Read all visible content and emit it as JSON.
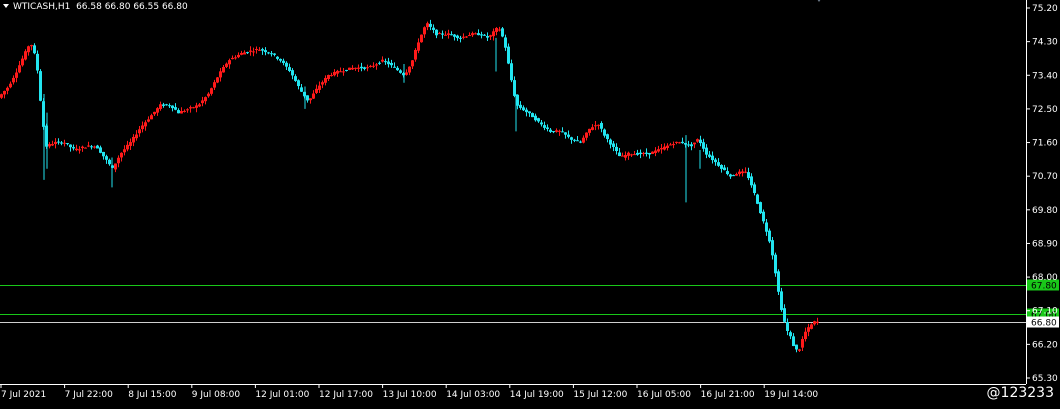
{
  "symbol": {
    "name": "WTICASH,H1",
    "ohlc": "66.58 66.80 66.55 66.80"
  },
  "watermark": "@123233",
  "colors": {
    "background": "#000000",
    "bull": "#ff1a1a",
    "bear": "#22e5f0",
    "hline": "#19c819",
    "axis": "#ffffff"
  },
  "chart_data": {
    "type": "candlestick",
    "title": "WTICASH,H1",
    "ylim": [
      65.2,
      75.3
    ],
    "y_ticks": [
      "75.20",
      "74.30",
      "73.40",
      "72.50",
      "71.60",
      "70.70",
      "69.80",
      "68.90",
      "68.00",
      "67.10",
      "66.20",
      "65.30"
    ],
    "x_ticks": [
      "7 Jul 2021",
      "7 Jul 22:00",
      "8 Jul 15:00",
      "9 Jul 08:00",
      "12 Jul 01:00",
      "12 Jul 17:00",
      "13 Jul 10:00",
      "14 Jul 03:00",
      "14 Jul 19:00",
      "15 Jul 12:00",
      "16 Jul 05:00",
      "16 Jul 21:00",
      "19 Jul 14:00"
    ],
    "horizontal_lines": [
      {
        "value": 67.8,
        "label": "67.80"
      },
      {
        "value": 67.0,
        "label": "67.00"
      },
      {
        "value": 66.8,
        "label": "66.80"
      }
    ],
    "current_price": {
      "value": 66.8,
      "label": "66.80"
    },
    "price_path": [
      [
        0,
        72.8
      ],
      [
        10,
        73.1
      ],
      [
        18,
        73.5
      ],
      [
        25,
        73.9
      ],
      [
        32,
        74.3
      ],
      [
        38,
        73.8
      ],
      [
        44,
        72.2
      ],
      [
        48,
        71.5
      ],
      [
        56,
        71.6
      ],
      [
        66,
        71.6
      ],
      [
        76,
        71.4
      ],
      [
        88,
        71.5
      ],
      [
        98,
        71.5
      ],
      [
        106,
        71.2
      ],
      [
        114,
        70.9
      ],
      [
        122,
        71.3
      ],
      [
        132,
        71.6
      ],
      [
        142,
        72.0
      ],
      [
        152,
        72.3
      ],
      [
        162,
        72.6
      ],
      [
        172,
        72.6
      ],
      [
        180,
        72.4
      ],
      [
        190,
        72.5
      ],
      [
        200,
        72.6
      ],
      [
        210,
        72.9
      ],
      [
        220,
        73.4
      ],
      [
        230,
        73.8
      ],
      [
        244,
        74.0
      ],
      [
        260,
        74.1
      ],
      [
        272,
        74.0
      ],
      [
        282,
        73.8
      ],
      [
        292,
        73.5
      ],
      [
        302,
        73.0
      ],
      [
        310,
        72.7
      ],
      [
        320,
        73.1
      ],
      [
        330,
        73.4
      ],
      [
        340,
        73.5
      ],
      [
        355,
        73.6
      ],
      [
        370,
        73.6
      ],
      [
        385,
        73.8
      ],
      [
        396,
        73.6
      ],
      [
        406,
        73.4
      ],
      [
        414,
        73.8
      ],
      [
        420,
        74.3
      ],
      [
        428,
        74.8
      ],
      [
        438,
        74.5
      ],
      [
        450,
        74.5
      ],
      [
        462,
        74.4
      ],
      [
        472,
        74.5
      ],
      [
        482,
        74.5
      ],
      [
        490,
        74.4
      ],
      [
        500,
        74.7
      ],
      [
        506,
        74.3
      ],
      [
        512,
        73.4
      ],
      [
        518,
        72.6
      ],
      [
        524,
        72.5
      ],
      [
        534,
        72.3
      ],
      [
        542,
        72.1
      ],
      [
        552,
        71.9
      ],
      [
        562,
        71.9
      ],
      [
        572,
        71.7
      ],
      [
        582,
        71.6
      ],
      [
        592,
        72.0
      ],
      [
        600,
        72.1
      ],
      [
        606,
        71.8
      ],
      [
        614,
        71.5
      ],
      [
        622,
        71.2
      ],
      [
        630,
        71.3
      ],
      [
        640,
        71.3
      ],
      [
        650,
        71.3
      ],
      [
        660,
        71.4
      ],
      [
        668,
        71.5
      ],
      [
        676,
        71.6
      ],
      [
        684,
        71.6
      ],
      [
        692,
        71.5
      ],
      [
        700,
        71.7
      ],
      [
        708,
        71.3
      ],
      [
        716,
        71.1
      ],
      [
        724,
        70.9
      ],
      [
        732,
        70.7
      ],
      [
        740,
        70.8
      ],
      [
        748,
        70.8
      ],
      [
        754,
        70.4
      ],
      [
        760,
        69.9
      ],
      [
        766,
        69.4
      ],
      [
        772,
        68.9
      ],
      [
        776,
        68.3
      ],
      [
        780,
        67.6
      ],
      [
        784,
        67.0
      ],
      [
        788,
        66.6
      ],
      [
        792,
        66.4
      ],
      [
        796,
        66.1
      ],
      [
        800,
        66.0
      ],
      [
        806,
        66.5
      ],
      [
        812,
        66.7
      ],
      [
        816,
        66.8
      ]
    ]
  }
}
